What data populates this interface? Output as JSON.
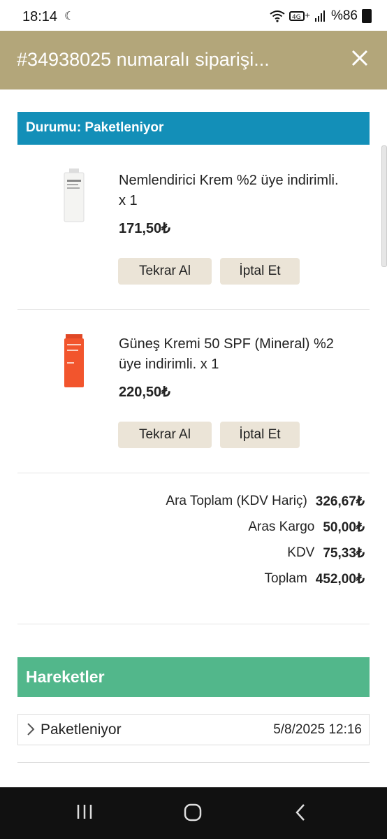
{
  "status_bar": {
    "time": "18:14",
    "battery": "%86"
  },
  "header": {
    "title": "#34938025 numaralı siparişi..."
  },
  "order": {
    "status_label": "Durumu: Paketleniyor",
    "items": [
      {
        "name": "Nemlendirici Krem %2 üye indirimli. x 1",
        "price": "171,50₺",
        "reorder_label": "Tekrar Al",
        "cancel_label": "İptal Et",
        "tube_color": "#f4f4f2",
        "tube_text": "Nemlendirici Krem"
      },
      {
        "name": "Güneş Kremi 50 SPF (Mineral) %2 üye indirimli. x 1",
        "price": "220,50₺",
        "reorder_label": "Tekrar Al",
        "cancel_label": "İptal Et",
        "tube_color": "#f2552d",
        "tube_text": "Güneş Kremi"
      }
    ],
    "totals": [
      {
        "label": "Ara Toplam (KDV Hariç)",
        "value": "326,67₺"
      },
      {
        "label": "Aras Kargo",
        "value": "50,00₺"
      },
      {
        "label": "KDV",
        "value": "75,33₺"
      },
      {
        "label": "Toplam",
        "value": "452,00₺"
      }
    ]
  },
  "history": {
    "title": "Hareketler",
    "rows": [
      {
        "label": "Paketleniyor",
        "date": "5/8/2025 12:16"
      }
    ]
  },
  "colors": {
    "header_bg": "#b3a67a",
    "status_bg": "#138fb8",
    "history_bg": "#52b78b",
    "button_bg": "#ebe4d7"
  }
}
